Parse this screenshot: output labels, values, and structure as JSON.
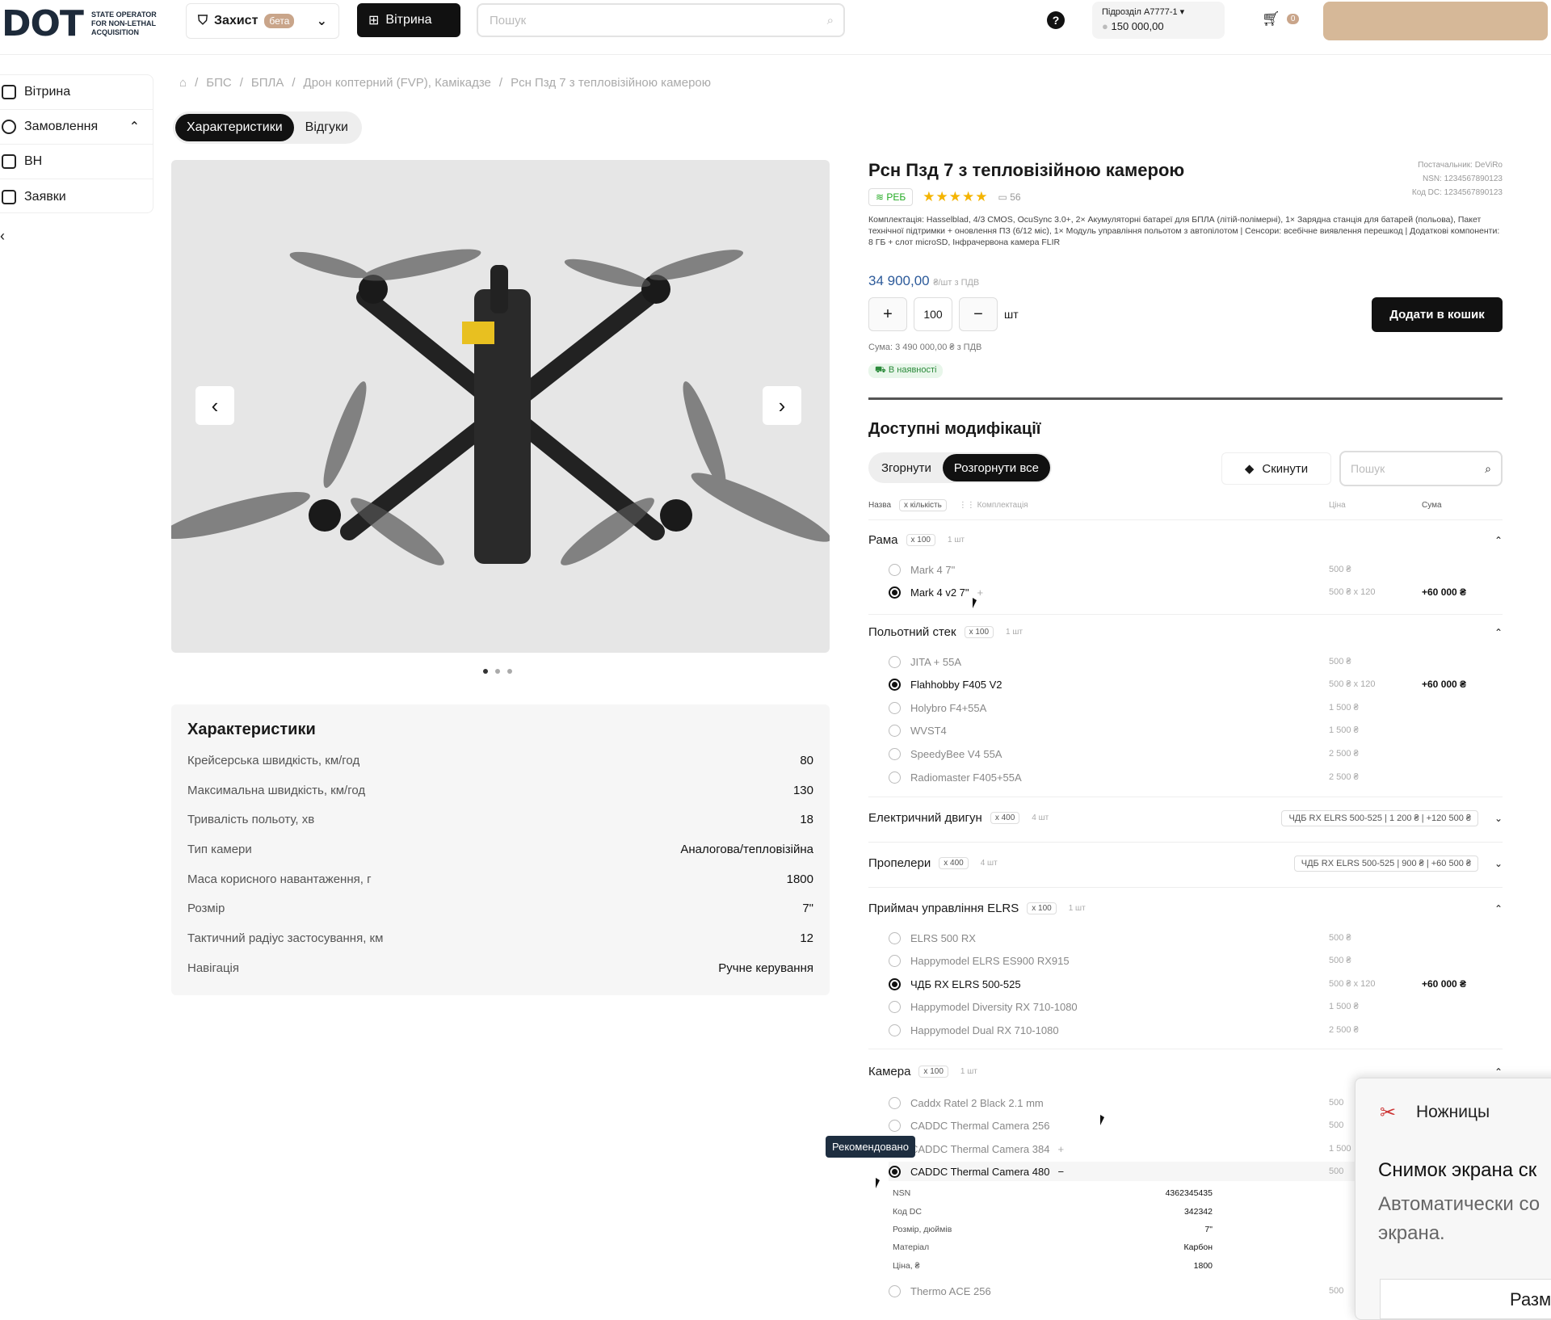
{
  "header": {
    "logo": "DOT",
    "logo_sub": "STATE OPERATOR FOR NON-LETHAL ACQUISITION",
    "zakhyst": "Захист",
    "beta": "бета",
    "vitryna": "Вітрина",
    "search_placeholder": "Пошук",
    "unit": "Підрозділ А7777-1",
    "balance": "150 000,00",
    "cart_count": "0"
  },
  "sidebar": {
    "items": [
      {
        "label": "Вітрина"
      },
      {
        "label": "Замовлення"
      },
      {
        "label": "ВН"
      },
      {
        "label": "Заявки"
      }
    ]
  },
  "breadcrumb": [
    "БПС",
    "БПЛА",
    "Дрон коптерний (FVP), Камікадзе",
    "Рсн Пзд 7 з тепловізійною камерою"
  ],
  "tabs": [
    "Характеристики",
    "Відгуки"
  ],
  "specs": {
    "title": "Характеристики",
    "rows": [
      {
        "k": "Крейсерська швидкість, км/год",
        "v": "80"
      },
      {
        "k": "Максимальна швидкість, км/год",
        "v": "130"
      },
      {
        "k": "Тривалість польоту, хв",
        "v": "18"
      },
      {
        "k": "Тип камери",
        "v": "Аналогова/тепловізійна"
      },
      {
        "k": "Маса корисного навантаження, г",
        "v": "1800"
      },
      {
        "k": "Розмір",
        "v": "7\""
      },
      {
        "k": "Тактичний радіус застосування, км",
        "v": "12"
      },
      {
        "k": "Навігація",
        "v": "Ручне керування"
      }
    ]
  },
  "product": {
    "title": "Рсн Пзд 7 з тепловізійною камерою",
    "supplier": "Постачальник: DeViRo",
    "nsn": "NSN: 1234567890123",
    "kod": "Код DC: 1234567890123",
    "reb": "РЕБ",
    "rating_count": "56",
    "kompl": "Комплектація: Hasselblad, 4/3 CMOS, OcuSync 3.0+, 2× Акумуляторні батареї для БПЛА (літій-полімерні), 1× Зарядна станція для батарей (польова), Пакет технічної підтримки + оновлення ПЗ (6/12 міс), 1× Модуль управління польотом з автопілотом | Сенсори: всебічне виявлення перешкод | Додаткові компоненти: 8 ГБ + слот microSD, Інфрачервона камера FLIR",
    "price": "34 900,00",
    "price_unit": "₴/шт з ПДВ",
    "qty": "100",
    "qty_unit": "шт",
    "add_to_cart": "Додати в кошик",
    "sum": "Сума: 3 490 000,00 ₴ з ПДВ",
    "stock": "В наявності"
  },
  "mods": {
    "title": "Доступні модифікації",
    "collapse": "Згорнути",
    "expand": "Розгорнути все",
    "reset": "Скинути",
    "search_placeholder": "Пошук",
    "col_name": "Назва",
    "col_qty": "x кількість",
    "col_kompl": "Комплектація",
    "col_price": "Ціна",
    "col_sum": "Сума",
    "groups": [
      {
        "name": "Рама",
        "mult": "x 100",
        "kit": "1 шт",
        "options": [
          {
            "name": "Mark 4 7\"",
            "price": "500 ₴",
            "sel": false
          },
          {
            "name": "Mark 4 v2 7\"",
            "price": "500 ₴ x 120",
            "total": "+60 000 ₴",
            "sel": true
          }
        ]
      },
      {
        "name": "Польотний стек",
        "mult": "x 100",
        "kit": "1 шт",
        "options": [
          {
            "name": "JITA + 55A",
            "price": "500 ₴",
            "sel": false
          },
          {
            "name": "Flahhobby F405 V2",
            "price": "500 ₴ x 120",
            "total": "+60 000 ₴",
            "sel": true
          },
          {
            "name": "Holybro F4+55A",
            "price": "1 500 ₴",
            "sel": false
          },
          {
            "name": "WVST4",
            "price": "1 500 ₴",
            "sel": false
          },
          {
            "name": "SpeedyBee V4 55A",
            "price": "2 500 ₴",
            "sel": false
          },
          {
            "name": "Radiomaster F405+55A",
            "price": "2 500 ₴",
            "sel": false
          }
        ]
      },
      {
        "name": "Електричний двигун",
        "mult": "x 400",
        "kit": "4 шт",
        "summary": "ЧДБ RX ELRS 500-525 | 1 200 ₴ | +120 500 ₴"
      },
      {
        "name": "Пропелери",
        "mult": "x 400",
        "kit": "4 шт",
        "summary": "ЧДБ RX ELRS 500-525 | 900 ₴ | +60 500 ₴"
      },
      {
        "name": "Приймач управління ELRS",
        "mult": "x 100",
        "kit": "1 шт",
        "options": [
          {
            "name": "ELRS 500 RX",
            "price": "500 ₴",
            "sel": false
          },
          {
            "name": "Happymodel ELRS ES900 RX915",
            "price": "500 ₴",
            "sel": false
          },
          {
            "name": "ЧДБ RX ELRS 500-525",
            "price": "500 ₴ x 120",
            "total": "+60 000 ₴",
            "sel": true
          },
          {
            "name": "Happymodel Diversity RX 710-1080",
            "price": "1 500 ₴",
            "sel": false
          },
          {
            "name": "Happymodel Dual RX 710-1080",
            "price": "2 500 ₴",
            "sel": false
          }
        ]
      },
      {
        "name": "Камера",
        "mult": "x 100",
        "kit": "1 шт",
        "options": [
          {
            "name": "Caddx Ratel 2 Black 2.1 mm",
            "price": "500",
            "sel": false
          },
          {
            "name": "CADDC Thermal Camera 256",
            "price": "500",
            "sel": false
          },
          {
            "name": "CADDC Thermal Camera 384",
            "price": "1 500",
            "sel": false
          },
          {
            "name": "CADDC Thermal Camera 480",
            "price": "500",
            "sel": true
          },
          {
            "name": "Thermo ACE 256",
            "price": "500",
            "sel": false
          }
        ]
      }
    ],
    "detail": [
      {
        "k": "NSN",
        "v": "4362345435"
      },
      {
        "k": "Код DC",
        "v": "342342"
      },
      {
        "k": "Розмір, дюймів",
        "v": "7\""
      },
      {
        "k": "Матеріал",
        "v": "Карбон"
      },
      {
        "k": "Ціна, ₴",
        "v": "1800"
      }
    ],
    "tooltip": "Рекомендовано"
  },
  "snipping": {
    "title": "Ножницы",
    "line1": "Снимок экрана ск",
    "line2": "Автоматически со экрана.",
    "button": "Разм"
  }
}
